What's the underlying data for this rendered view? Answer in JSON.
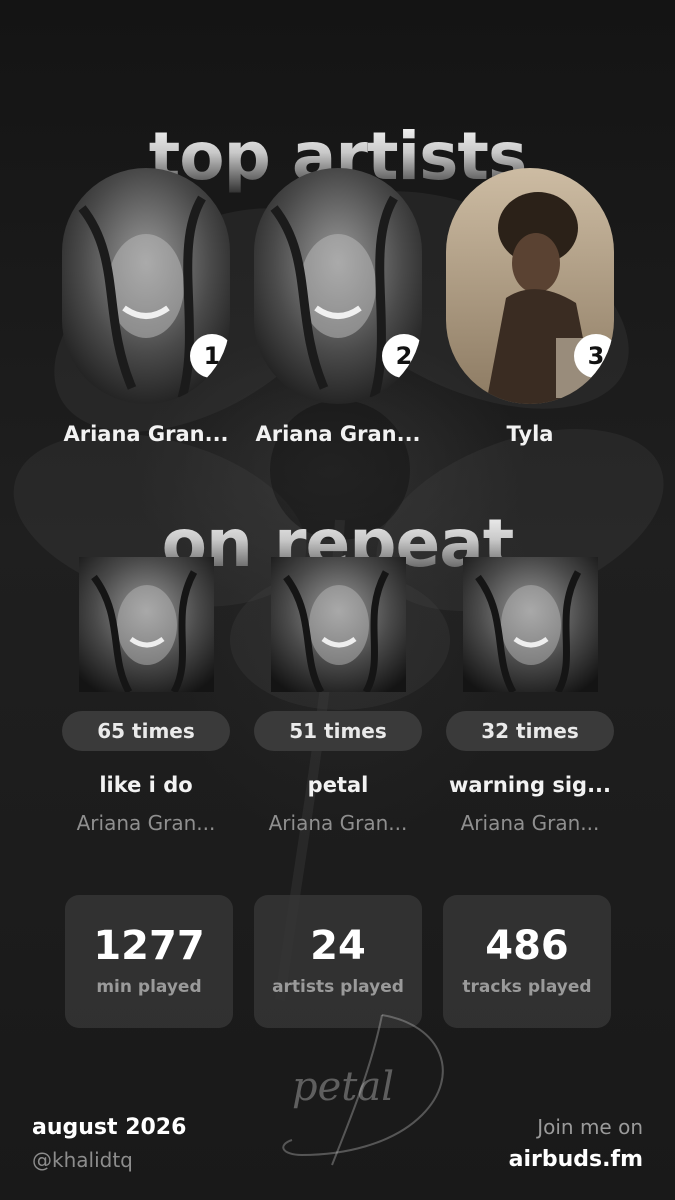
{
  "titles": {
    "top_artists": "top artists",
    "on_repeat": "on repeat"
  },
  "top_artists": [
    {
      "rank": "1",
      "name": "Ariana Gran..."
    },
    {
      "rank": "2",
      "name": "Ariana Gran..."
    },
    {
      "rank": "3",
      "name": "Tyla"
    }
  ],
  "on_repeat": [
    {
      "times": "65 times",
      "title": "like i do",
      "artist": "Ariana Gran..."
    },
    {
      "times": "51 times",
      "title": "petal",
      "artist": "Ariana Gran..."
    },
    {
      "times": "32 times",
      "title": "warning sig...",
      "artist": "Ariana Gran..."
    }
  ],
  "stats": [
    {
      "value": "1277",
      "label": "min played"
    },
    {
      "value": "24",
      "label": "artists played"
    },
    {
      "value": "486",
      "label": "tracks played"
    }
  ],
  "footer": {
    "date": "august 2026",
    "handle": "@khalidtq",
    "join": "Join me on",
    "site": "airbuds.fm"
  },
  "decor": {
    "script_text": "petal"
  },
  "colors": {
    "background": "#1a1a1a",
    "pill": "#3a3a3a",
    "card": "#373737",
    "muted": "#8f8f8f"
  }
}
